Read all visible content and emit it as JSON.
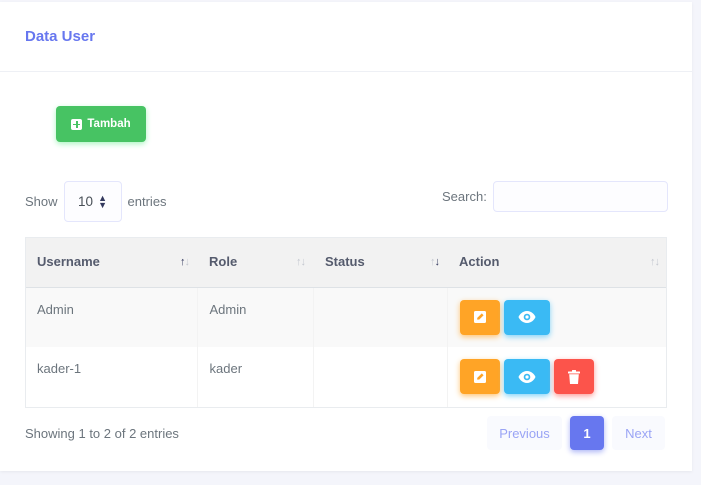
{
  "card": {
    "title": "Data User"
  },
  "toolbar": {
    "add_label": "Tambah",
    "add_icon": "plus-square-icon"
  },
  "length": {
    "show_label": "Show",
    "value": "10",
    "entries_label": "entries"
  },
  "search": {
    "label": "Search:",
    "value": "",
    "placeholder": ""
  },
  "table": {
    "headers": [
      "Username",
      "Role",
      "Status",
      "Action"
    ],
    "rows": [
      {
        "username": "Admin",
        "role": "Admin",
        "status": "",
        "actions": [
          "edit",
          "view"
        ]
      },
      {
        "username": "kader-1",
        "role": "kader",
        "status": "",
        "actions": [
          "edit",
          "view",
          "delete"
        ]
      }
    ]
  },
  "footer": {
    "info": "Showing 1 to 2 of 2 entries",
    "previous": "Previous",
    "page": "1",
    "next": "Next"
  },
  "colors": {
    "primary": "#6777ef",
    "success": "#47c363",
    "warning": "#ffa426",
    "info": "#3abaf4",
    "danger": "#fc544b"
  }
}
